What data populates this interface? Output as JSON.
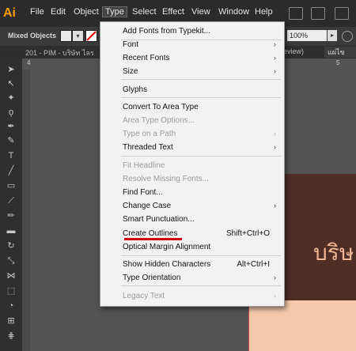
{
  "app": {
    "logo": "Ai"
  },
  "menubar": {
    "items": [
      "File",
      "Edit",
      "Object",
      "Type",
      "Select",
      "Effect",
      "View",
      "Window",
      "Help"
    ],
    "icons": [
      "bridge-icon",
      "stock-icon",
      "arrange-icon"
    ]
  },
  "controlbar": {
    "label": "Mixed Objects",
    "zoom": "100%"
  },
  "tabbar": {
    "left": "201 - PIM - บริษัท ไลร",
    "right": "review)",
    "right2": "แผ่ไข"
  },
  "ruler": {
    "mark1": "4",
    "mark2": "5"
  },
  "canvas": {
    "thai_text": "บริษ"
  },
  "dropdown": {
    "items": [
      {
        "label": "Add Fonts from Typekit...",
        "shortcut": "",
        "submenu": false,
        "disabled": false
      },
      {
        "label": "Font",
        "shortcut": "",
        "submenu": true,
        "disabled": false
      },
      {
        "label": "Recent Fonts",
        "shortcut": "",
        "submenu": true,
        "disabled": false
      },
      {
        "label": "Size",
        "shortcut": "",
        "submenu": true,
        "disabled": false
      },
      {
        "label": "Glyphs",
        "shortcut": "",
        "submenu": false,
        "disabled": false
      },
      {
        "label": "Convert To Area Type",
        "shortcut": "",
        "submenu": false,
        "disabled": false
      },
      {
        "label": "Area Type Options...",
        "shortcut": "",
        "submenu": false,
        "disabled": true
      },
      {
        "label": "Type on a Path",
        "shortcut": "",
        "submenu": true,
        "disabled": true
      },
      {
        "label": "Threaded Text",
        "shortcut": "",
        "submenu": true,
        "disabled": false
      },
      {
        "label": "Fit Headline",
        "shortcut": "",
        "submenu": false,
        "disabled": true
      },
      {
        "label": "Resolve Missing Fonts...",
        "shortcut": "",
        "submenu": false,
        "disabled": true
      },
      {
        "label": "Find Font...",
        "shortcut": "",
        "submenu": false,
        "disabled": false
      },
      {
        "label": "Change Case",
        "shortcut": "",
        "submenu": true,
        "disabled": false
      },
      {
        "label": "Smart Punctuation...",
        "shortcut": "",
        "submenu": false,
        "disabled": false
      },
      {
        "label": "Create Outlines",
        "shortcut": "Shift+Ctrl+O",
        "submenu": false,
        "disabled": false
      },
      {
        "label": "Optical Margin Alignment",
        "shortcut": "",
        "submenu": false,
        "disabled": false
      },
      {
        "label": "Show Hidden Characters",
        "shortcut": "Alt+Ctrl+I",
        "submenu": false,
        "disabled": false
      },
      {
        "label": "Type Orientation",
        "shortcut": "",
        "submenu": true,
        "disabled": false
      },
      {
        "label": "Legacy Text",
        "shortcut": "",
        "submenu": true,
        "disabled": true
      }
    ]
  },
  "tools": [
    "selection-tool-icon",
    "direct-selection-tool-icon",
    "magic-wand-tool-icon",
    "lasso-tool-icon",
    "pen-tool-icon",
    "curvature-tool-icon",
    "type-tool-icon",
    "line-tool-icon",
    "rectangle-tool-icon",
    "paintbrush-tool-icon",
    "pencil-tool-icon",
    "eraser-tool-icon",
    "rotate-tool-icon",
    "scale-tool-icon",
    "width-tool-icon",
    "free-transform-tool-icon",
    "shape-builder-tool-icon",
    "perspective-grid-tool-icon",
    "mesh-tool-icon",
    "gradient-tool-icon"
  ]
}
